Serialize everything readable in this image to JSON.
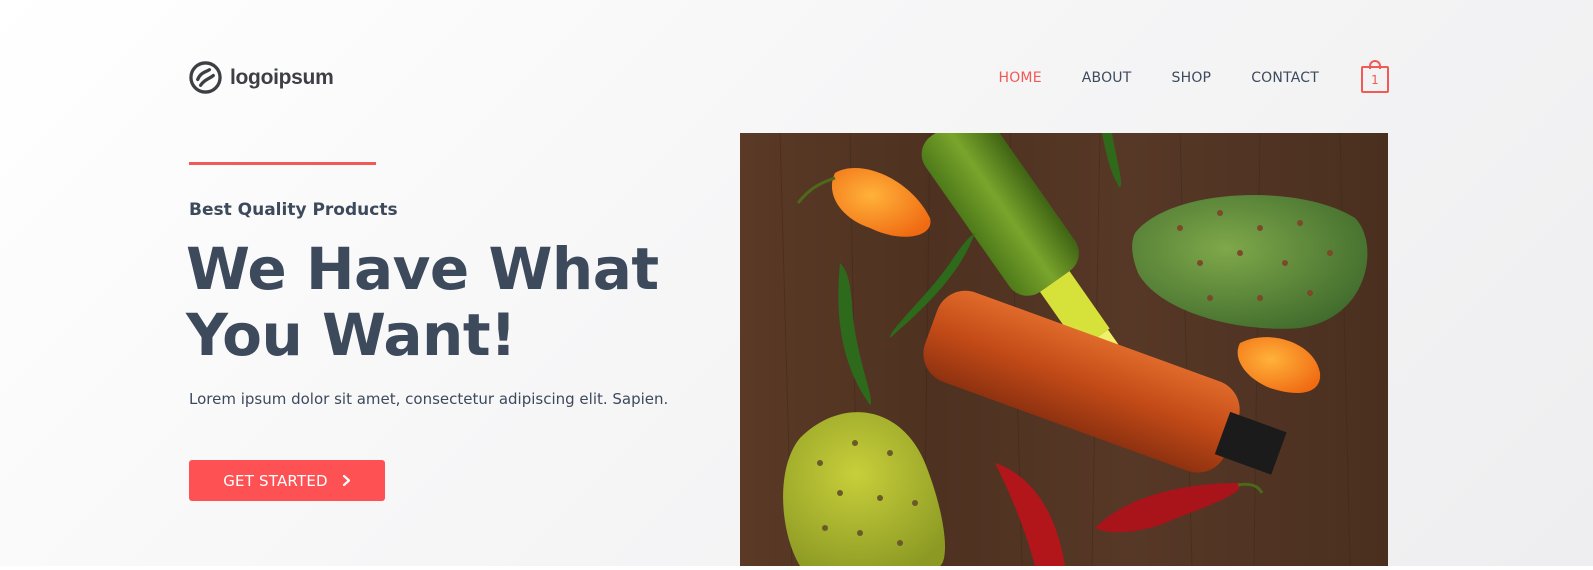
{
  "header": {
    "logo_text": "logoipsum",
    "logo_icon": "logo-mark-icon",
    "nav": [
      {
        "label": "HOME",
        "active": true
      },
      {
        "label": "ABOUT",
        "active": false
      },
      {
        "label": "SHOP",
        "active": false
      },
      {
        "label": "CONTACT",
        "active": false
      }
    ],
    "cart_count": "1",
    "cart_icon": "shopping-bag-icon"
  },
  "hero": {
    "eyebrow": "Best Quality Products",
    "headline_line1": "We Have What",
    "headline_line2": "You Want!",
    "subtext": "Lorem ipsum dolor sit amet, consectetur adipiscing elit. Sapien.",
    "cta_label": "GET STARTED",
    "cta_icon": "chevron-right-icon",
    "image_subject": "hot-sauce-bottles-and-peppers-photo"
  },
  "colors": {
    "accent": "#f05a57",
    "button": "#fe5154",
    "text": "#3d4a5c",
    "background": "#f4f4f5"
  }
}
